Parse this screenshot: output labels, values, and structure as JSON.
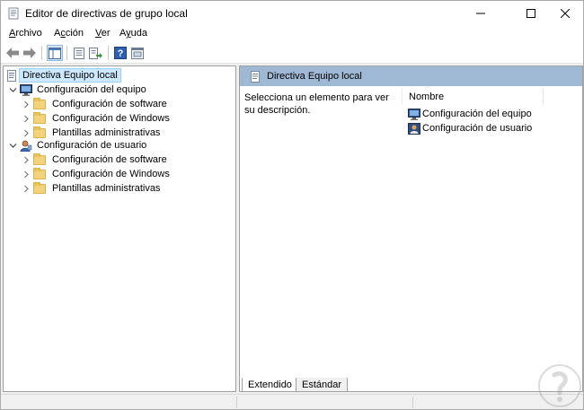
{
  "window": {
    "title": "Editor de directivas de grupo local"
  },
  "menu": {
    "items": [
      {
        "label": "Archivo",
        "accel": "A",
        "rest": "rchivo"
      },
      {
        "label": "Acción",
        "accel": "c",
        "pre": "A",
        "rest": "ción"
      },
      {
        "label": "Ver",
        "accel": "V",
        "rest": "er"
      },
      {
        "label": "Ayuda",
        "accel": "y",
        "pre": "A",
        "rest": "uda"
      }
    ]
  },
  "toolbar": {
    "buttons": [
      "back-arrow-icon",
      "forward-arrow-icon",
      "show-hide-tree-icon",
      "properties-icon",
      "export-list-icon",
      "help-icon",
      "view-icon"
    ]
  },
  "tree": {
    "root": "Directiva Equipo local",
    "nodes": [
      {
        "label": "Configuración del equipo",
        "children": [
          "Configuración de software",
          "Configuración de Windows",
          "Plantillas administrativas"
        ]
      },
      {
        "label": "Configuración de usuario",
        "children": [
          "Configuración de software",
          "Configuración de Windows",
          "Plantillas administrativas"
        ]
      }
    ]
  },
  "details": {
    "header": "Directiva Equipo local",
    "description": "Selecciona un elemento para ver su descripción.",
    "column_name": "Nombre",
    "items": [
      "Configuración del equipo",
      "Configuración de usuario"
    ]
  },
  "tabs": {
    "extended": "Extendido",
    "standard": "Estándar"
  },
  "colors": {
    "header_bg": "#9fb9d4",
    "selection_bg": "#cce8ff",
    "folder": "#f2d27a"
  }
}
